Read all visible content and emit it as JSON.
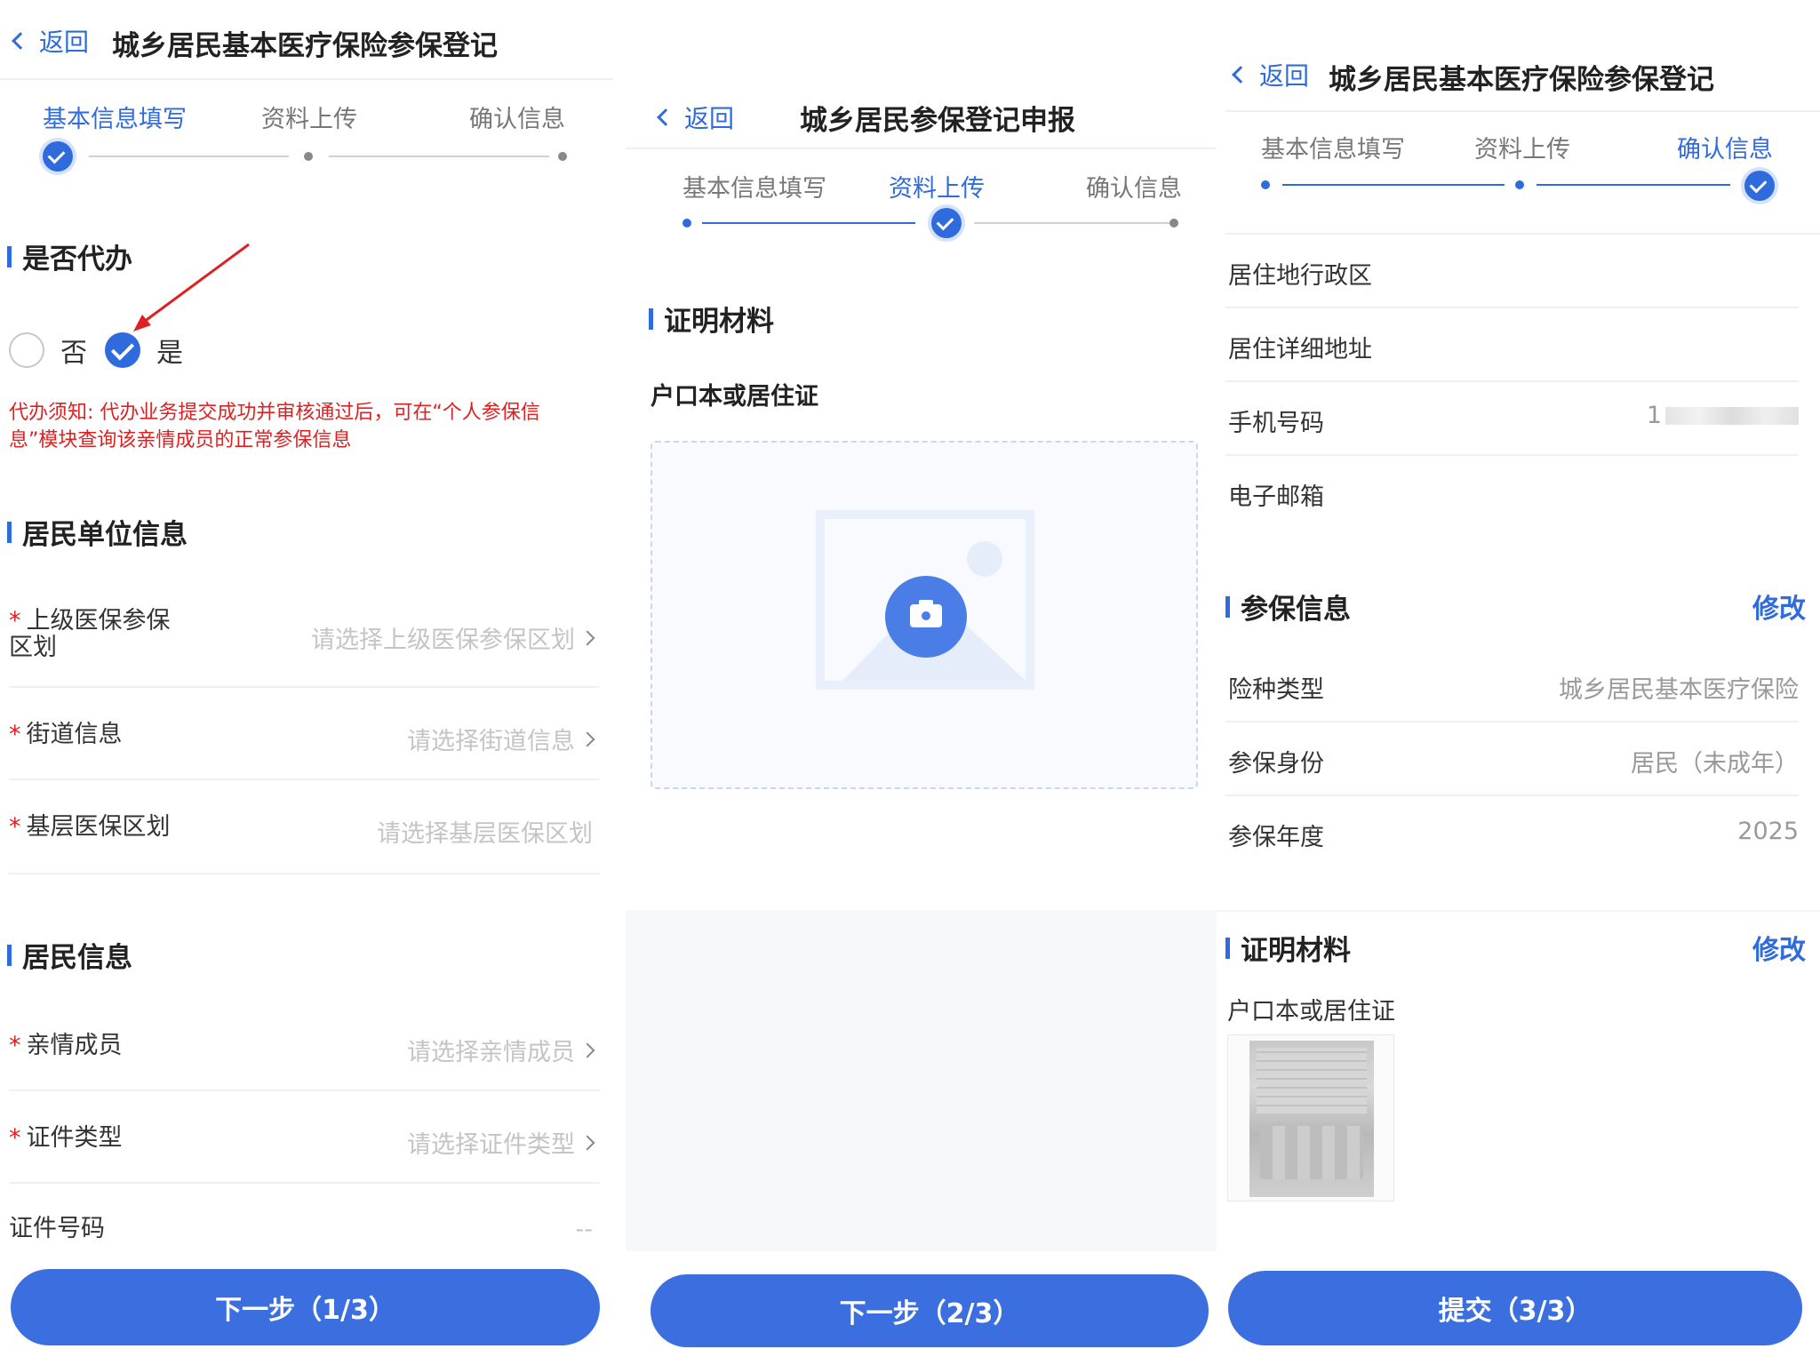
{
  "panel1": {
    "back": "返回",
    "title": "城乡居民基本医疗保险参保登记",
    "steps": [
      "基本信息填写",
      "资料上传",
      "确认信息"
    ],
    "sec_proxy": "是否代办",
    "opt_no": "否",
    "opt_yes": "是",
    "notice": "代办须知: 代办业务提交成功并审核通过后，可在“个人参保信息”模块查询该亲情成员的正常参保信息",
    "sec_unit": "居民单位信息",
    "unit_rows": [
      {
        "label": "上级医保参保区划",
        "placeholder": "请选择上级医保参保区划"
      },
      {
        "label": "街道信息",
        "placeholder": "请选择街道信息"
      },
      {
        "label": "基层医保区划",
        "placeholder": "请选择基层医保区划"
      }
    ],
    "sec_resident": "居民信息",
    "resident_rows": [
      {
        "label": "亲情成员",
        "placeholder": "请选择亲情成员"
      },
      {
        "label": "证件类型",
        "placeholder": "请选择证件类型"
      }
    ],
    "id_label": "证件号码",
    "id_value": "--",
    "button": "下一步（1/3）"
  },
  "panel2": {
    "back": "返回",
    "title": "城乡居民参保登记申报",
    "steps": [
      "基本信息填写",
      "资料上传",
      "确认信息"
    ],
    "sec_material": "证明材料",
    "doc_label": "户口本或居住证",
    "button": "下一步（2/3）"
  },
  "panel3": {
    "back": "返回",
    "title": "城乡居民基本医疗保险参保登记",
    "steps": [
      "基本信息填写",
      "资料上传",
      "确认信息"
    ],
    "info_rows": [
      {
        "label": "居住地行政区",
        "value": ""
      },
      {
        "label": "居住详细地址",
        "value": ""
      },
      {
        "label": "手机号码",
        "value": "1"
      },
      {
        "label": "电子邮箱",
        "value": ""
      }
    ],
    "sec_insurance": "参保信息",
    "modify": "修改",
    "ins_rows": [
      {
        "label": "险种类型",
        "value": "城乡居民基本医疗保险"
      },
      {
        "label": "参保身份",
        "value": "居民（未成年）"
      },
      {
        "label": "参保年度",
        "value": "2025"
      }
    ],
    "sec_material": "证明材料",
    "modify2": "修改",
    "doc_label": "户口本或居住证",
    "button": "提交（3/3）"
  },
  "colors": {
    "accent": "#2f6bdc",
    "button": "#3b6fe0",
    "required": "#e02020"
  }
}
